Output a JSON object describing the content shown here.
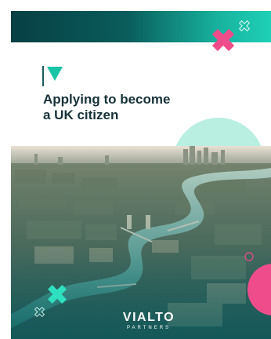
{
  "document": {
    "title_line1": "Applying to become",
    "title_line2": "a UK citizen"
  },
  "brand": {
    "name": "VIALTO",
    "tagline": "PARTNERS"
  },
  "colors": {
    "teal_dark": "#073f44",
    "teal_bright": "#1fd0b6",
    "mint": "#b9efe1",
    "pink": "#ef4c8b",
    "title_text": "#17323a"
  },
  "icons": [
    "chevron-logo-icon",
    "pink-x-icon",
    "teal-x-icon",
    "outline-x-icon"
  ]
}
